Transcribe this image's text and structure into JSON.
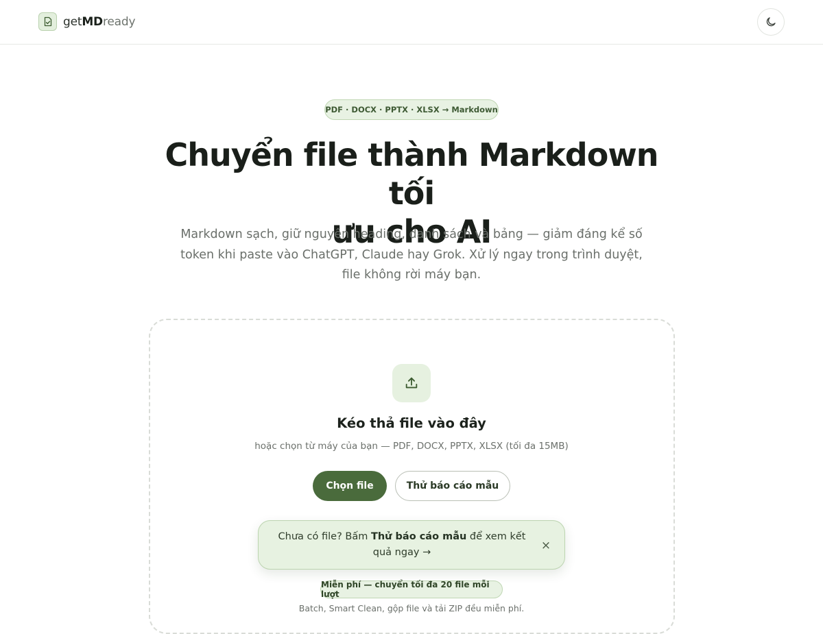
{
  "header": {
    "logo_prefix": "get",
    "logo_bold": "MD",
    "logo_suffix": "ready",
    "logo_icon": "file-check-icon",
    "theme_icon": "moon-icon"
  },
  "hero": {
    "formats_badge": "PDF · DOCX · PPTX · XLSX → Markdown",
    "title_line1": "Chuyển file thành Markdown tối",
    "title_line2": "ưu cho AI",
    "subtitle": "Markdown sạch, giữ nguyên heading, danh sách và bảng — giảm đáng kể số token khi paste vào ChatGPT, Claude hay Grok. Xử lý ngay trong trình duyệt, file không rời máy bạn."
  },
  "dropzone": {
    "upload_icon": "upload-icon",
    "title": "Kéo thả file vào đây",
    "hint": "hoặc chọn từ máy của bạn — PDF, DOCX, PPTX, XLSX (tối đa 15MB)",
    "choose_label": "Chọn file",
    "sample_label": "Thử báo cáo mẫu"
  },
  "tip": {
    "prefix": "Chưa có file? Bấm ",
    "bold": "Thử báo cáo mẫu",
    "suffix": " để xem kết quả ngay →",
    "close_symbol": "×"
  },
  "free": {
    "badge": "Miễn phí — chuyển tối đa 20 file mỗi lượt",
    "note": "Batch, Smart Clean, gộp file và tải ZIP đều miễn phí."
  },
  "colors": {
    "accent": "#4a6b3c",
    "accent_soft": "#e8f2e3"
  }
}
